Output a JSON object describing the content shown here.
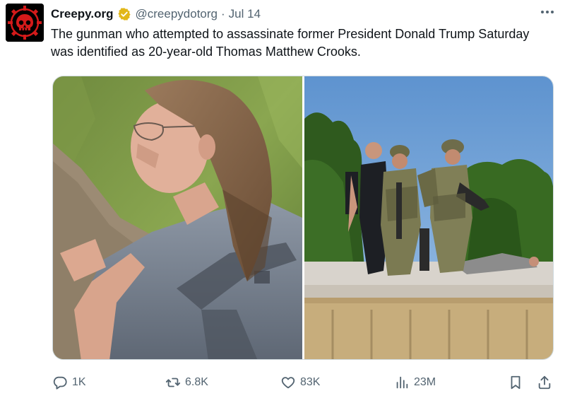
{
  "author": {
    "display_name": "Creepy.org",
    "handle": "@creepydotorg",
    "separator": "·",
    "date": "Jul 14",
    "verified_icon": "verified-gold-badge-icon",
    "avatar_icon": "red-skull-gear-logo"
  },
  "tweet": {
    "text": "The gunman who attempted to assassinate former President Donald Trump Saturday was identified as 20-year-old Thomas Matthew Crooks."
  },
  "media": {
    "photo_count": 2
  },
  "actions": {
    "reply": {
      "icon": "reply-icon",
      "count": "1K"
    },
    "retweet": {
      "icon": "retweet-icon",
      "count": "6.8K"
    },
    "like": {
      "icon": "heart-icon",
      "count": "83K"
    },
    "views": {
      "icon": "views-icon",
      "count": "23M"
    },
    "bookmark": {
      "icon": "bookmark-icon"
    },
    "share": {
      "icon": "share-icon"
    }
  },
  "colors": {
    "text_primary": "#0f1419",
    "text_secondary": "#536471",
    "verified_gold": "#e2b719",
    "avatar_red": "#d41a1a"
  }
}
